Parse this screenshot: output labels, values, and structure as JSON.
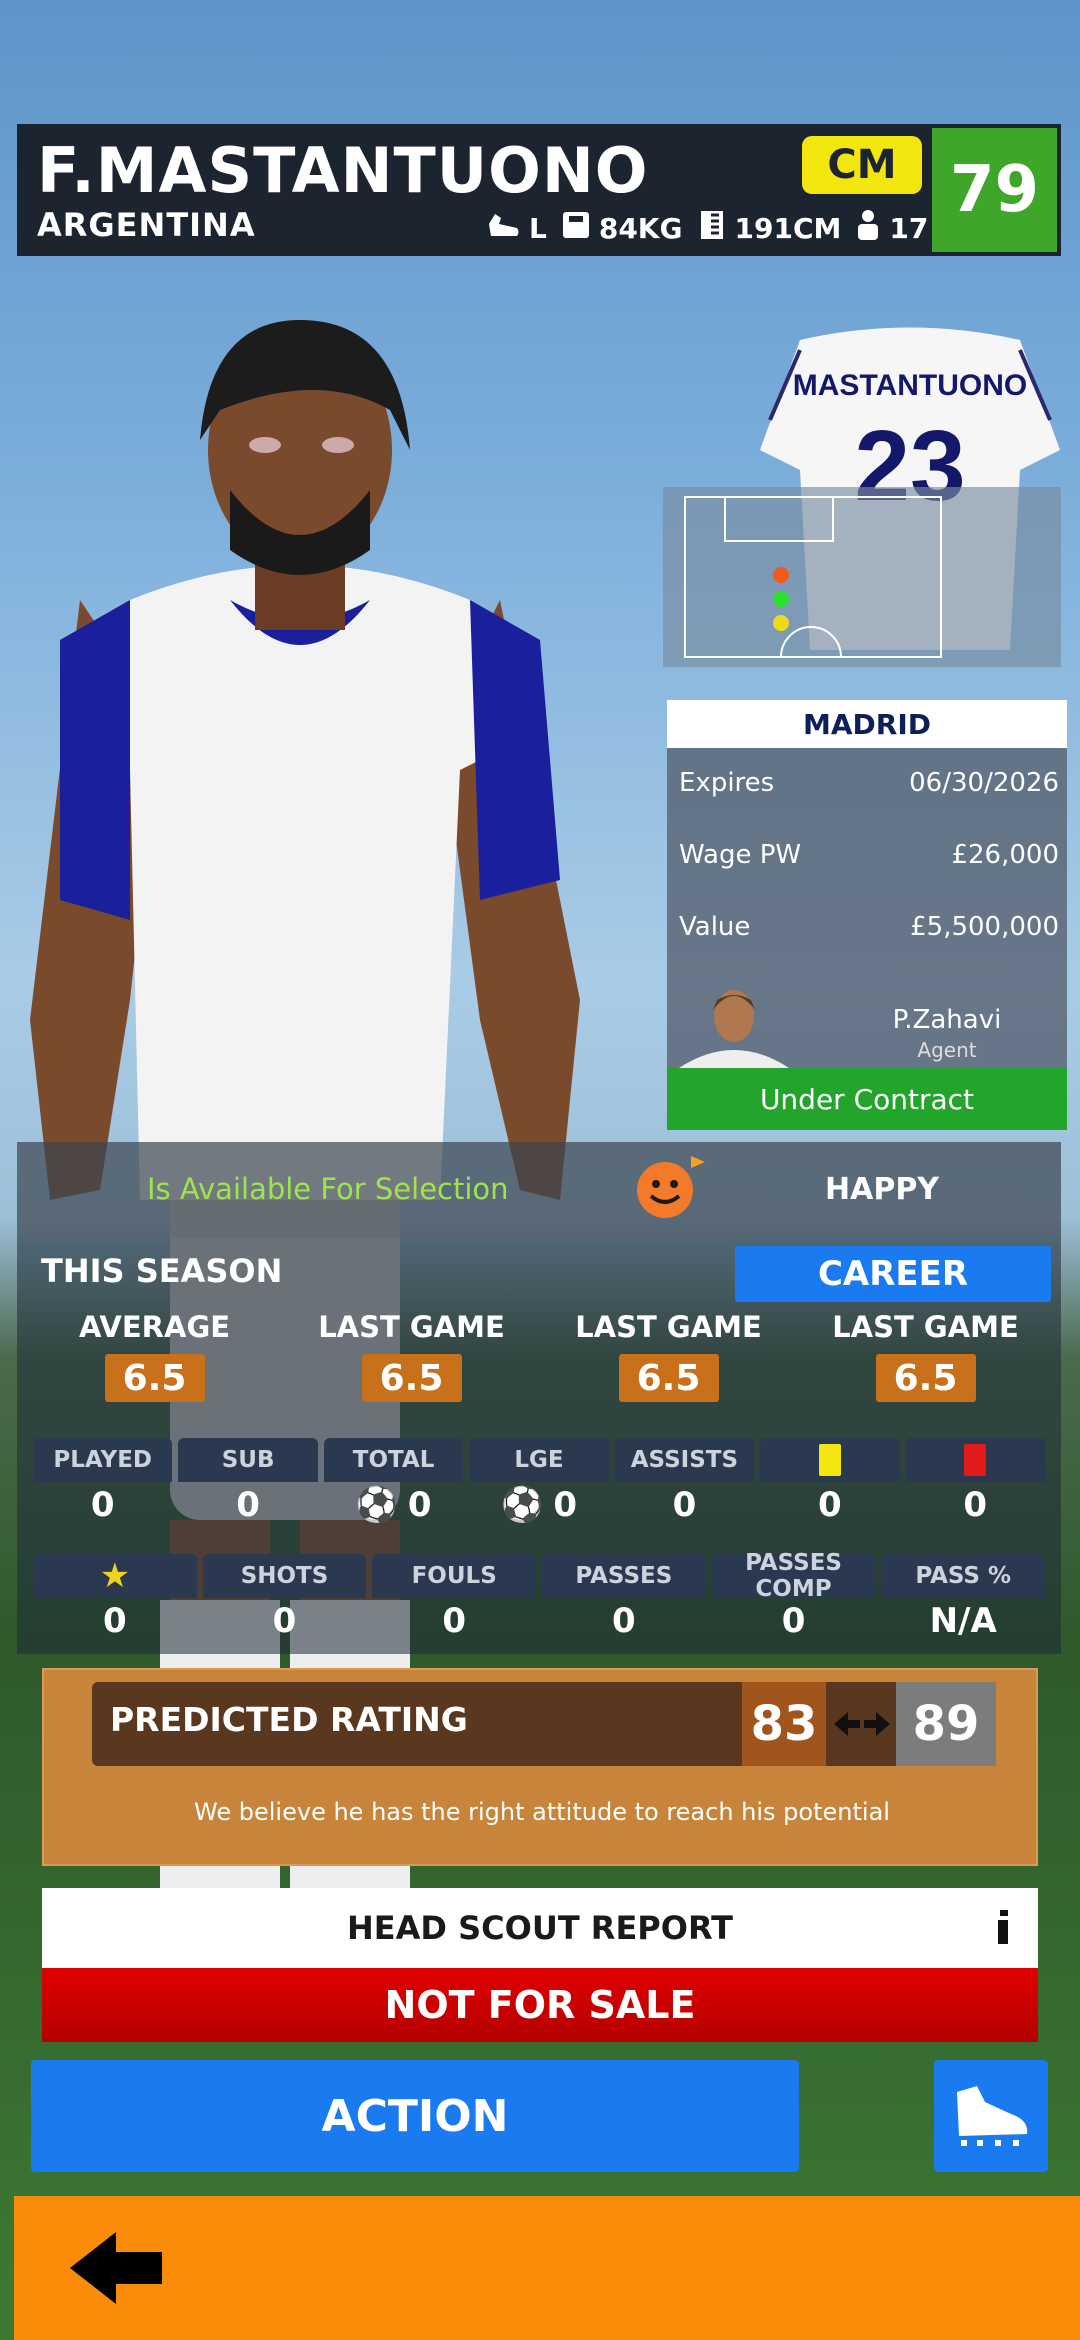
{
  "player": {
    "name": "F.MASTANTUONO",
    "nation": "ARGENTINA",
    "foot": "L",
    "weight": "84KG",
    "height": "191CM",
    "age": "17",
    "position": "CM",
    "rating": "79"
  },
  "jersey": {
    "name": "MASTANTUONO",
    "number": "23"
  },
  "contract": {
    "club": "MADRID",
    "expires_label": "Expires",
    "expires": "06/30/2026",
    "wage_label": "Wage PW",
    "wage": "£26,000",
    "value_label": "Value",
    "value": "£5,500,000",
    "agent_name": "P.Zahavi",
    "agent_label": "Agent",
    "status": "Under Contract"
  },
  "availability": {
    "text": "Is Available For Selection",
    "morale": "HAPPY"
  },
  "season": {
    "label": "THIS SEASON",
    "career_button": "CAREER",
    "ratings": [
      {
        "label": "AVERAGE",
        "value": "6.5"
      },
      {
        "label": "LAST GAME",
        "value": "6.5"
      },
      {
        "label": "LAST GAME",
        "value": "6.5"
      },
      {
        "label": "LAST GAME",
        "value": "6.5"
      }
    ],
    "row1": [
      {
        "label": "PLAYED",
        "value": "0"
      },
      {
        "label": "SUB",
        "value": "0"
      },
      {
        "label": "TOTAL",
        "value": "0"
      },
      {
        "label": "LGE",
        "value": "0"
      },
      {
        "label": "ASSISTS",
        "value": "0"
      },
      {
        "label": "",
        "value": "0"
      },
      {
        "label": "",
        "value": "0"
      }
    ],
    "row2": [
      {
        "label": "",
        "value": "0"
      },
      {
        "label": "SHOTS",
        "value": "0"
      },
      {
        "label": "FOULS",
        "value": "0"
      },
      {
        "label": "PASSES",
        "value": "0"
      },
      {
        "label": "PASSES COMP",
        "value": "0"
      },
      {
        "label": "PASS %",
        "value": "N/A"
      }
    ]
  },
  "predicted": {
    "label": "PREDICTED RATING",
    "min": "83",
    "max": "89",
    "text": "We believe he has the right attitude to reach his potential"
  },
  "scout": {
    "label": "HEAD SCOUT REPORT",
    "sale_status": "NOT FOR SALE"
  },
  "action": {
    "label": "ACTION"
  },
  "colors": {
    "accent_blue": "#1a7af0",
    "orange": "#fb8c0a",
    "rating_green": "#3ea629",
    "position_yellow": "#f3e60f",
    "sale_red": "#d00000"
  }
}
